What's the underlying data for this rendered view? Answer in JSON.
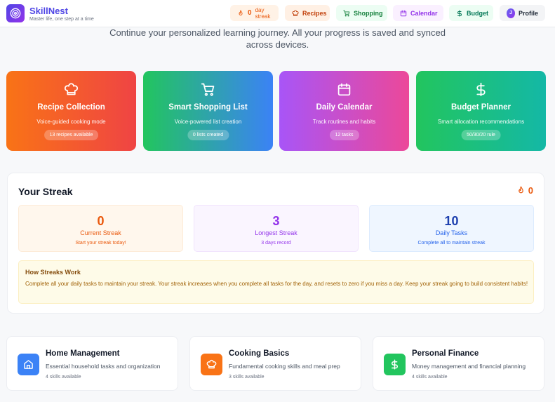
{
  "header": {
    "brand": "SkillNest",
    "tagline": "Master life, one step at a time",
    "nav": {
      "streak_count": "0",
      "streak_label": "day streak",
      "recipes": "Recipes",
      "shopping": "Shopping",
      "calendar": "Calendar",
      "budget": "Budget",
      "profile_initial": "J",
      "profile": "Profile"
    }
  },
  "intro": "Continue your personalized learning journey. All your progress is saved and synced across devices.",
  "features": [
    {
      "title": "Recipe Collection",
      "desc": "Voice-guided cooking mode",
      "badge": "13 recipes available",
      "icon": "chef-hat-icon"
    },
    {
      "title": "Smart Shopping List",
      "desc": "Voice-powered list creation",
      "badge": "0 lists created",
      "icon": "cart-icon"
    },
    {
      "title": "Daily Calendar",
      "desc": "Track routines and habits",
      "badge": "12 tasks",
      "icon": "calendar-icon"
    },
    {
      "title": "Budget Planner",
      "desc": "Smart allocation recommendations",
      "badge": "50/30/20 rule",
      "icon": "dollar-icon"
    }
  ],
  "streak": {
    "title": "Your Streak",
    "count": "0",
    "stats": [
      {
        "value": "0",
        "label": "Current Streak",
        "sub": "Start your streak today!"
      },
      {
        "value": "3",
        "label": "Longest Streak",
        "sub": "3 days record"
      },
      {
        "value": "10",
        "label": "Daily Tasks",
        "sub": "Complete all to maintain streak"
      }
    ],
    "how_title": "How Streaks Work",
    "how_text": "Complete all your daily tasks to maintain your streak. Your streak increases when you complete all tasks for the day, and resets to zero if you miss a day. Keep your streak going to build consistent habits!"
  },
  "categories": [
    {
      "title": "Home Management",
      "desc": "Essential household tasks and organization",
      "count": "4 skills available",
      "icon": "home-icon"
    },
    {
      "title": "Cooking Basics",
      "desc": "Fundamental cooking skills and meal prep",
      "count": "3 skills available",
      "icon": "chef-hat-icon"
    },
    {
      "title": "Personal Finance",
      "desc": "Money management and financial planning",
      "count": "4 skills available",
      "icon": "dollar-icon"
    }
  ],
  "colors": {
    "brand": "#4f46e5",
    "streak": "#ea580c",
    "longest": "#9333ea",
    "tasks": "#2563eb"
  }
}
